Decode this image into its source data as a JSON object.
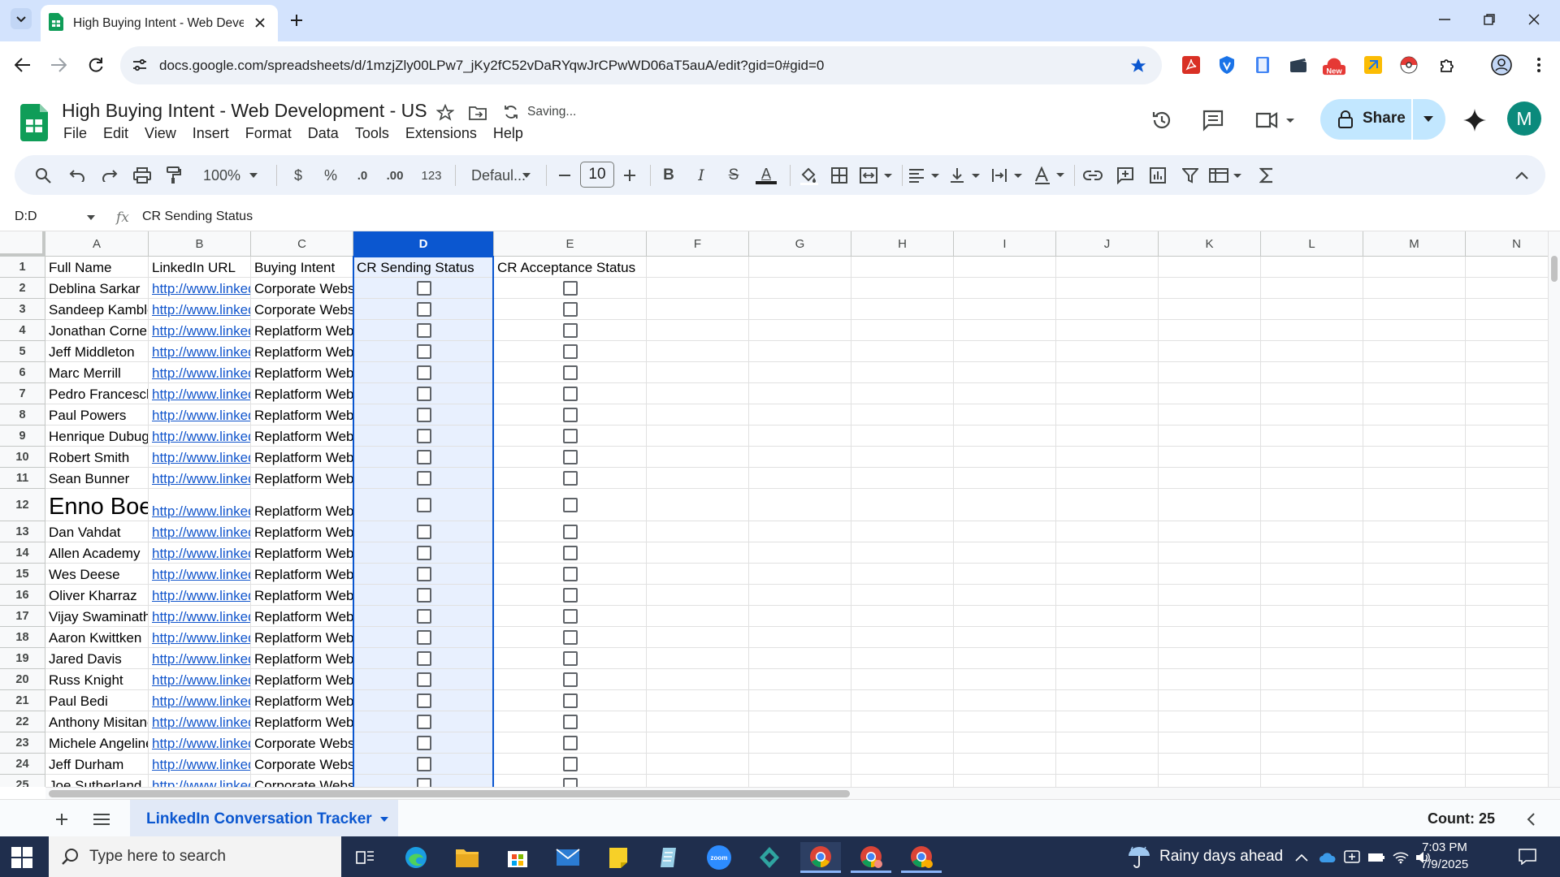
{
  "browser": {
    "tab_title": "High Buying Intent - Web Deve",
    "url": "docs.google.com/spreadsheets/d/1mzjZly00LPw7_jKy2fC52vDaRYqwJrCPwWD06aT5auA/edit?gid=0#gid=0"
  },
  "doc": {
    "title": "High Buying Intent - Web Development - US",
    "status": "Saving...",
    "menu": [
      "File",
      "Edit",
      "View",
      "Insert",
      "Format",
      "Data",
      "Tools",
      "Extensions",
      "Help"
    ],
    "share_label": "Share",
    "avatar_letter": "M"
  },
  "toolbar": {
    "zoom": "100%",
    "currency": "$",
    "percent": "%",
    "decrease_decimal": ".0",
    "increase_decimal": ".00",
    "number_format": "123",
    "font": "Defaul...",
    "font_size": "10",
    "bold": "B",
    "italic": "I",
    "strike": "S",
    "text_color_letter": "A"
  },
  "formula_bar": {
    "name_box": "D:D",
    "fx": "fx",
    "content": "CR Sending Status"
  },
  "sheet": {
    "columns": [
      "A",
      "B",
      "C",
      "D",
      "E",
      "F",
      "G",
      "H",
      "I",
      "J",
      "K",
      "L",
      "M",
      "N"
    ],
    "selected_column": "D",
    "headers": [
      "Full Name",
      "LinkedIn URL",
      "Buying Intent",
      "CR Sending Status",
      "CR Acceptance Status"
    ],
    "rows": [
      {
        "n": "2",
        "name": "Deblina Sarkar",
        "url": "http://www.linkedin",
        "intent": "Corporate Website"
      },
      {
        "n": "3",
        "name": "Sandeep Kamble",
        "url": "http://www.linkedin",
        "intent": "Corporate Website"
      },
      {
        "n": "4",
        "name": "Jonathan Cornelius",
        "url": "http://www.linkedin",
        "intent": "Replatform Website"
      },
      {
        "n": "5",
        "name": "Jeff Middleton",
        "url": "http://www.linkedin",
        "intent": "Replatform Website"
      },
      {
        "n": "6",
        "name": "Marc Merrill",
        "url": "http://www.linkedin",
        "intent": "Replatform Website"
      },
      {
        "n": "7",
        "name": "Pedro Franceschi",
        "url": "http://www.linkedin",
        "intent": "Replatform Website"
      },
      {
        "n": "8",
        "name": "Paul Powers",
        "url": "http://www.linkedin",
        "intent": "Replatform Website"
      },
      {
        "n": "9",
        "name": "Henrique Dubugras",
        "url": "http://www.linkedin",
        "intent": "Replatform Website"
      },
      {
        "n": "10",
        "name": "Robert Smith",
        "url": "http://www.linkedin",
        "intent": "Replatform Website"
      },
      {
        "n": "11",
        "name": "Sean Bunner",
        "url": "http://www.linkedin",
        "intent": "Replatform Website"
      },
      {
        "n": "12",
        "name": "Enno Boeck",
        "url": "http://www.linkedin",
        "intent": "Replatform Website",
        "big": true
      },
      {
        "n": "13",
        "name": "Dan Vahdat",
        "url": "http://www.linkedin",
        "intent": "Replatform Website"
      },
      {
        "n": "14",
        "name": "Allen Academy",
        "url": "http://www.linkedin",
        "intent": "Replatform Website"
      },
      {
        "n": "15",
        "name": "Wes Deese",
        "url": "http://www.linkedin",
        "intent": "Replatform Website"
      },
      {
        "n": "16",
        "name": "Oliver Kharraz",
        "url": "http://www.linkedin",
        "intent": "Replatform Website"
      },
      {
        "n": "17",
        "name": "Vijay Swaminathan",
        "url": "http://www.linkedin",
        "intent": "Replatform Website"
      },
      {
        "n": "18",
        "name": "Aaron Kwittken",
        "url": "http://www.linkedin",
        "intent": "Replatform Website"
      },
      {
        "n": "19",
        "name": "Jared Davis",
        "url": "http://www.linkedin",
        "intent": "Replatform Website"
      },
      {
        "n": "20",
        "name": "Russ Knight",
        "url": "http://www.linkedin",
        "intent": "Replatform Website"
      },
      {
        "n": "21",
        "name": "Paul Bedi",
        "url": "http://www.linkedin",
        "intent": "Replatform Website"
      },
      {
        "n": "22",
        "name": "Anthony Misitano",
        "url": "http://www.linkedin",
        "intent": "Replatform Website"
      },
      {
        "n": "23",
        "name": "Michele Angeline",
        "url": "http://www.linkedin",
        "intent": "Corporate Website"
      },
      {
        "n": "24",
        "name": "Jeff Durham",
        "url": "http://www.linkedin",
        "intent": "Corporate Website"
      },
      {
        "n": "25",
        "name": "Joe Sutherland",
        "url": "http://www.linkedin",
        "intent": "Corporate Website"
      }
    ],
    "tab_name": "LinkedIn Conversation Tracker",
    "count": "Count: 25"
  },
  "taskbar": {
    "search_placeholder": "Type here to search",
    "weather": "Rainy days ahead",
    "time": "7:03 PM",
    "date": "7/9/2025"
  },
  "colors": {
    "accent": "#0b57d0",
    "link": "#1155cc",
    "share_bg": "#c2e7ff",
    "sheets_green": "#0f9d58"
  }
}
